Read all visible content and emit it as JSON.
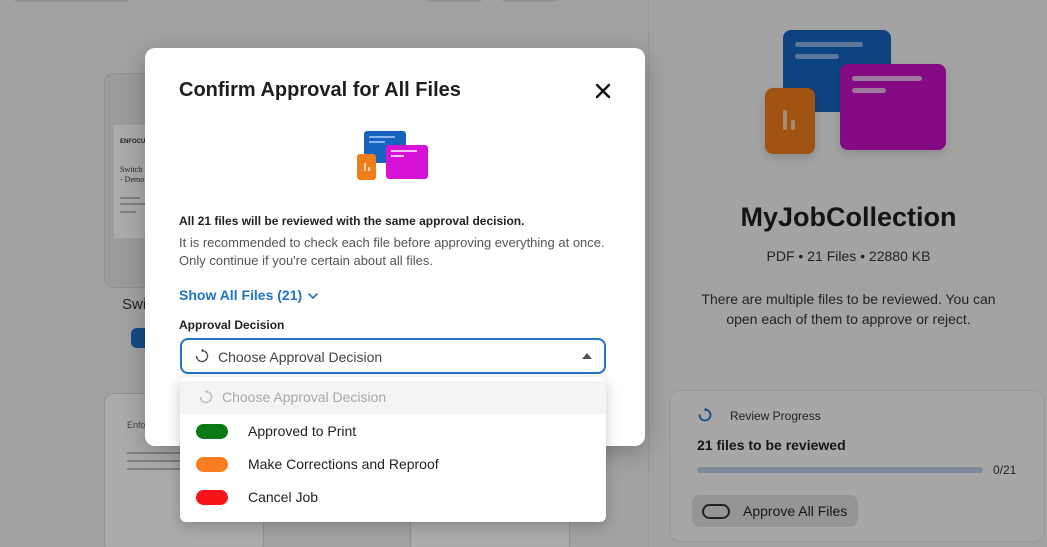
{
  "background": {
    "thumbnail_label": "Swi",
    "thumb_text": {
      "brand": "ENFOCUS",
      "line1": "Switch",
      "line2": "- Demo"
    },
    "thumb2_text": "Enfocus"
  },
  "right_panel": {
    "title": "MyJobCollection",
    "meta": "PDF • 21 Files • 22880 KB",
    "description": "There are multiple files to be reviewed. You can open each of them to approve or reject.",
    "progress": {
      "label": "Review Progress",
      "count_text": "21 files to be reviewed",
      "reviewed": 0,
      "total": 21,
      "ratio_text": "0/21",
      "approve_all_label": "Approve All Files"
    }
  },
  "modal": {
    "title": "Confirm Approval for All Files",
    "warning_strong": "All 21 files will be reviewed with the same approval decision.",
    "warning_text": "It is recommended to check each file before approving everything at once. Only continue if you're certain about all files.",
    "show_files_label": "Show All Files (21)",
    "decision_label": "Approval Decision",
    "decision_placeholder": "Choose Approval Decision"
  },
  "dropdown": {
    "placeholder": "Choose Approval Decision",
    "options": [
      {
        "label": "Approved to Print",
        "color": "#0b7a15"
      },
      {
        "label": "Make Corrections and Reproof",
        "color": "#f97e21"
      },
      {
        "label": "Cancel Job",
        "color": "#f5141a"
      }
    ]
  },
  "colors": {
    "accent": "#1f74c8",
    "modal_bg": "#ffffff"
  },
  "icons": {
    "close": "close-icon",
    "chevron": "chevron-down-icon",
    "review": "refresh-icon",
    "select_arrow": "caret-up-icon"
  }
}
